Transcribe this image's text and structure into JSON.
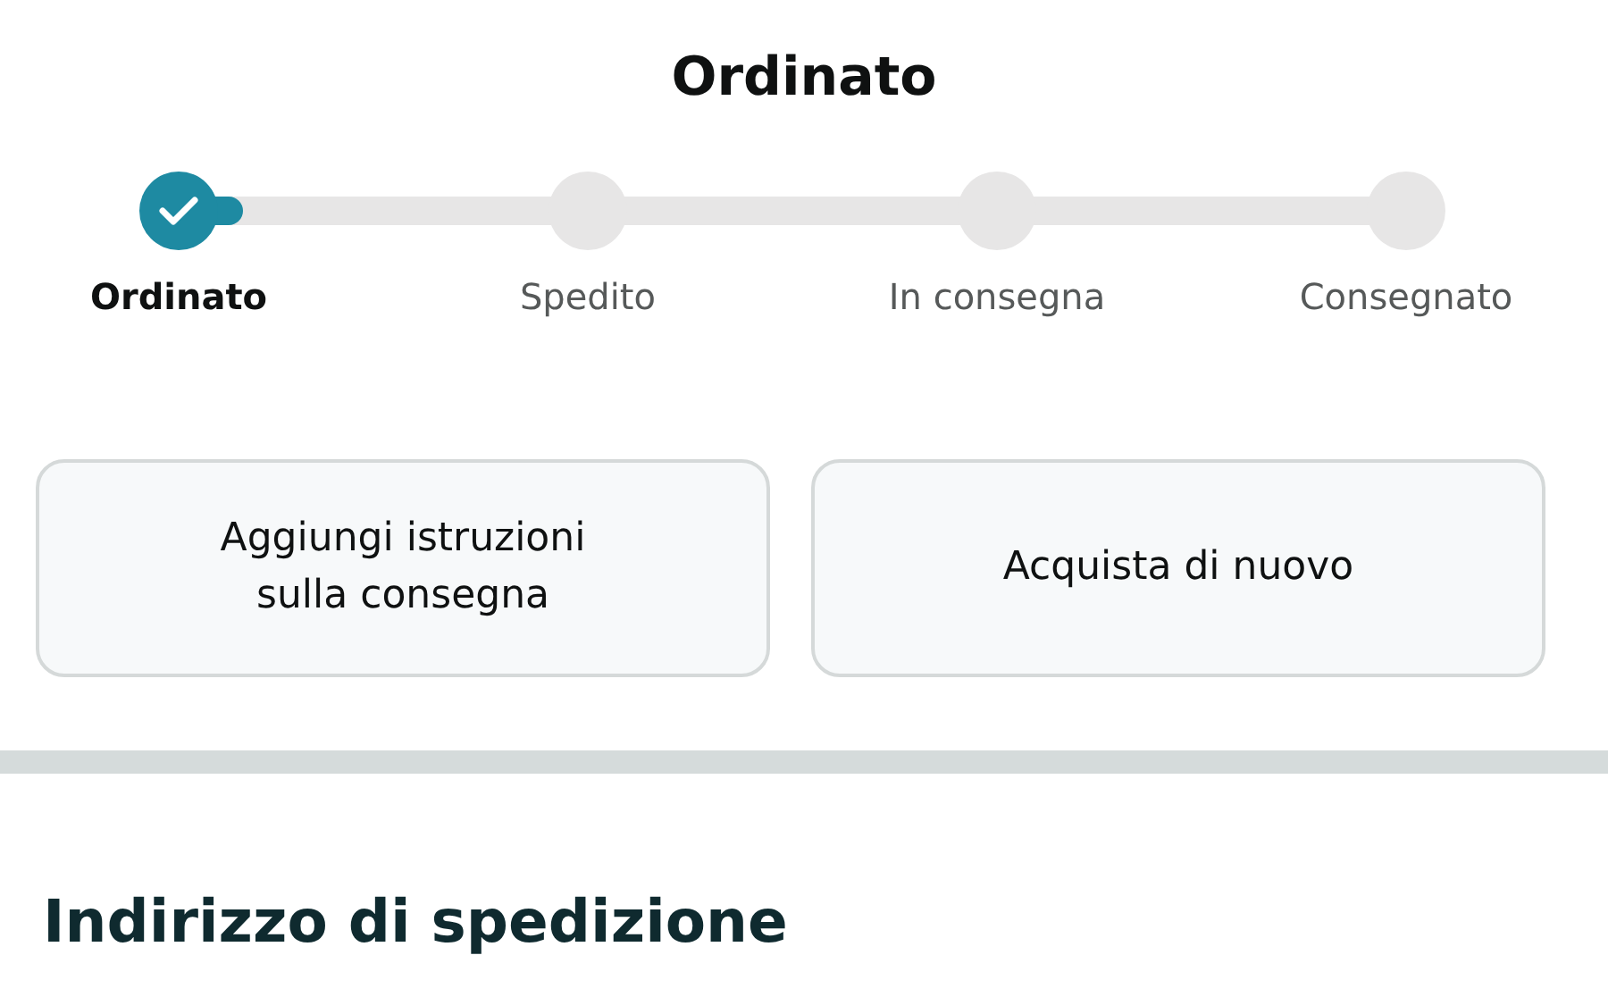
{
  "title": "Ordinato",
  "steps": [
    {
      "label": "Ordinato",
      "completed": true,
      "selected": true
    },
    {
      "label": "Spedito",
      "completed": false,
      "selected": false
    },
    {
      "label": "In consegna",
      "completed": false,
      "selected": false
    },
    {
      "label": "Consegnato",
      "completed": false,
      "selected": false
    }
  ],
  "buttons": [
    {
      "lines": [
        "Aggiungi istruzioni",
        "sulla consegna"
      ]
    },
    {
      "lines": [
        "Acquista di nuovo"
      ]
    }
  ],
  "section_heading": "Indirizzo di spedizione"
}
